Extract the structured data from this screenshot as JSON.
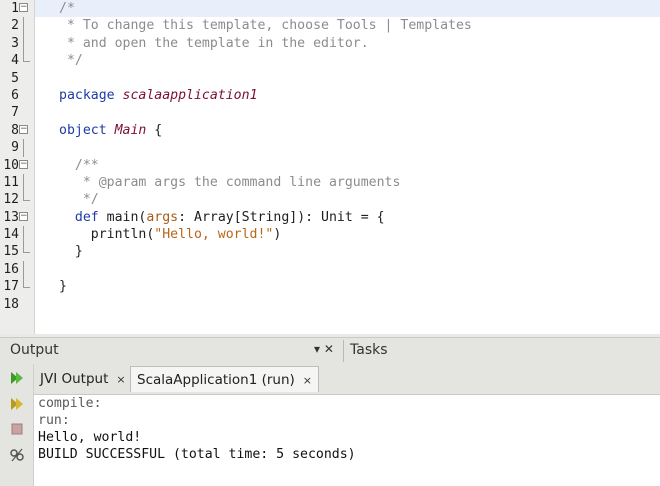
{
  "editor": {
    "lines": [
      {
        "n": "1",
        "html": "<span class=\"cm\">/*</span>",
        "fold": "start",
        "hl": true
      },
      {
        "n": "2",
        "html": "<span class=\"cm\"> * To change this template, choose Tools | Templates</span>",
        "fold": "line"
      },
      {
        "n": "3",
        "html": "<span class=\"cm\"> * and open the template in the editor.</span>",
        "fold": "line"
      },
      {
        "n": "4",
        "html": "<span class=\"cm\"> */</span>",
        "fold": "end"
      },
      {
        "n": "5",
        "html": "",
        "fold": ""
      },
      {
        "n": "6",
        "html": "<span class=\"kw\">package</span> <span class=\"pkg\">scalaapplication1</span>",
        "fold": ""
      },
      {
        "n": "7",
        "html": "",
        "fold": ""
      },
      {
        "n": "8",
        "html": "<span class=\"kw\">object</span> <span class=\"nm\">Main</span> {",
        "fold": "start"
      },
      {
        "n": "9",
        "html": "",
        "fold": "line"
      },
      {
        "n": "10",
        "html": "  <span class=\"cm\">/**</span>",
        "fold": "start"
      },
      {
        "n": "11",
        "html": "<span class=\"cm\">   * @param args the command line arguments</span>",
        "fold": "line"
      },
      {
        "n": "12",
        "html": "<span class=\"cm\">   */</span>",
        "fold": "end"
      },
      {
        "n": "13",
        "html": "  <span class=\"kw\">def</span> main(<span class=\"par\">args</span>: Array[String]): Unit = {",
        "fold": "start"
      },
      {
        "n": "14",
        "html": "    println(<span class=\"str\">\"Hello, world!\"</span>)",
        "fold": "line"
      },
      {
        "n": "15",
        "html": "  }",
        "fold": "end"
      },
      {
        "n": "16",
        "html": "",
        "fold": "line"
      },
      {
        "n": "17",
        "html": "}",
        "fold": "end"
      },
      {
        "n": "18",
        "html": "",
        "fold": ""
      }
    ]
  },
  "panel": {
    "title": "Output",
    "controls": "▾ ✕",
    "tasks_tab": "Tasks",
    "tabs": [
      {
        "label": "JVI Output",
        "close": "×",
        "active": false
      },
      {
        "label": "ScalaApplication1 (run)",
        "close": "×",
        "active": true
      }
    ],
    "output_lines": [
      {
        "text": "compile:",
        "cls": "gray"
      },
      {
        "text": "run:",
        "cls": "gray"
      },
      {
        "text": "Hello, world!",
        "cls": "black"
      },
      {
        "text": "BUILD SUCCESSFUL (total time: 5 seconds)",
        "cls": "black"
      }
    ]
  },
  "toolbar_icons": [
    "rerun-icon",
    "rerun-with-options-icon",
    "stop-icon",
    "output-settings-icon"
  ],
  "colors": {
    "keyword": "#1e3aa8",
    "comment": "#8c8c8c",
    "name": "#7a0e38",
    "string": "#b8671a",
    "current_line": "#e9effa"
  }
}
